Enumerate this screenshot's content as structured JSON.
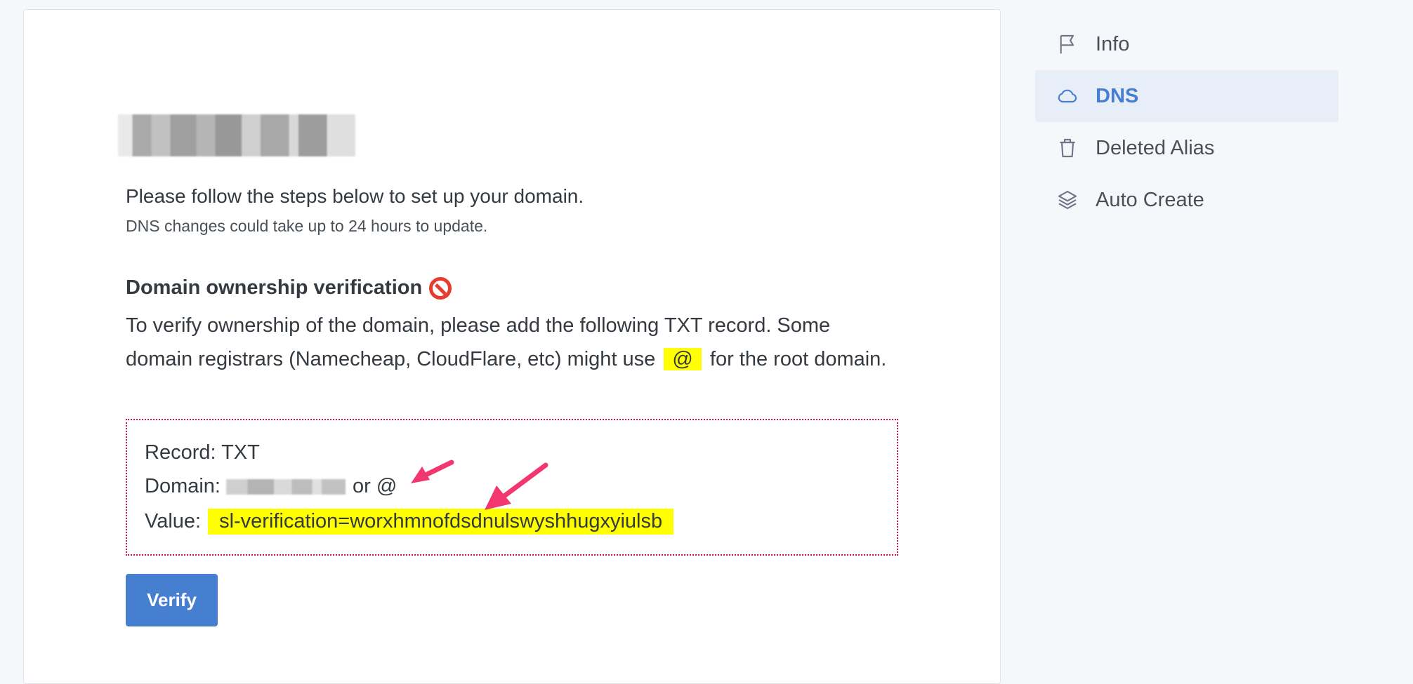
{
  "main": {
    "intro": "Please follow the steps below to set up your domain.",
    "intro_sub": "DNS changes could take up to 24 hours to update.",
    "verification": {
      "title": "Domain ownership verification",
      "status_icon": "no-entry-icon",
      "desc_before": "To verify ownership of the domain, please add the following TXT record. Some domain registrars (Namecheap, CloudFlare, etc) might use",
      "desc_highlight": "@",
      "desc_after": "for the root domain.",
      "record_label": "Record: TXT",
      "domain_label": "Domain:",
      "domain_or": "or @",
      "value_label": "Value:",
      "value": "sl-verification=worxhmnofdsdnulswyshhugxyiulsb"
    },
    "verify_button": "Verify"
  },
  "sidebar": {
    "items": [
      {
        "label": "Info",
        "icon": "flag-icon",
        "active": false
      },
      {
        "label": "DNS",
        "icon": "cloud-icon",
        "active": true
      },
      {
        "label": "Deleted Alias",
        "icon": "trash-icon",
        "active": false
      },
      {
        "label": "Auto Create",
        "icon": "layers-icon",
        "active": false
      }
    ]
  },
  "colors": {
    "accent": "#467fcf",
    "highlight": "#ffff00",
    "annotation_arrow": "#f2366f",
    "record_border": "#c2185b"
  }
}
